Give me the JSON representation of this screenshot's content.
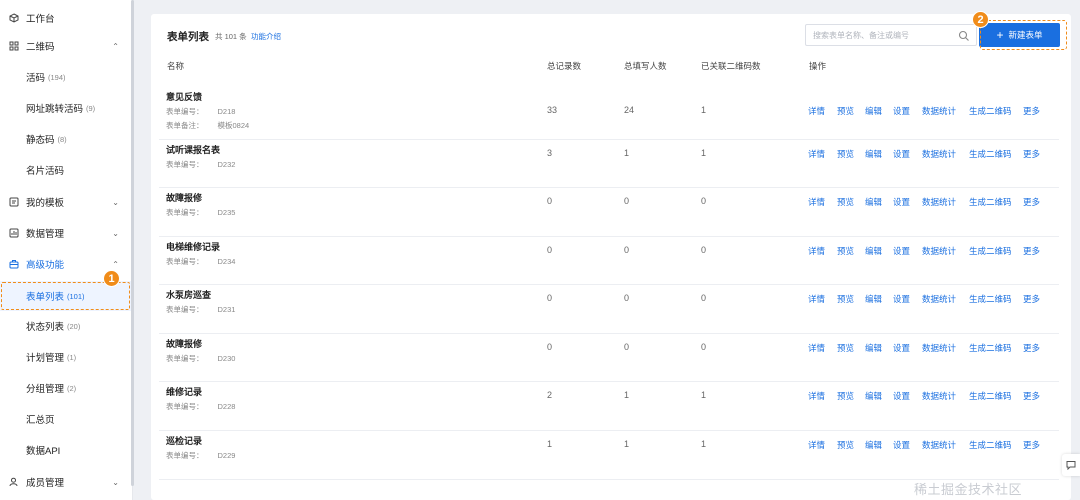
{
  "sidebar": {
    "workbench": "工作台",
    "qrcode": {
      "label": "二维码",
      "items": [
        {
          "label": "活码",
          "count": "(194)"
        },
        {
          "label": "网址跳转活码",
          "count": "(9)"
        },
        {
          "label": "静态码",
          "count": "(8)"
        },
        {
          "label": "名片活码",
          "count": ""
        }
      ]
    },
    "templates": "我的模板",
    "data_mgmt": "数据管理",
    "advanced": {
      "label": "高级功能",
      "items": [
        {
          "label": "表单列表",
          "count": "(101)"
        },
        {
          "label": "状态列表",
          "count": "(20)"
        },
        {
          "label": "计划管理",
          "count": "(1)"
        },
        {
          "label": "分组管理",
          "count": "(2)"
        },
        {
          "label": "汇总页",
          "count": ""
        },
        {
          "label": "数据API",
          "count": ""
        }
      ]
    },
    "members": "成员管理"
  },
  "badges": {
    "one": "1",
    "two": "2"
  },
  "header": {
    "title": "表单列表",
    "count": "共 101 条",
    "intro": "功能介绍",
    "search_placeholder": "搜索表单名称、备注或编号",
    "new_button": "新建表单"
  },
  "table": {
    "columns": [
      "名称",
      "总记录数",
      "总填写人数",
      "已关联二维码数",
      "操作"
    ],
    "id_label": "表单编号：",
    "note_label": "表单备注：",
    "actions": [
      "详情",
      "预览",
      "编辑",
      "设置",
      "数据统计",
      "生成二维码",
      "更多"
    ],
    "rows": [
      {
        "name": "意见反馈",
        "id": "D218",
        "note": "模板0824",
        "records": "33",
        "writers": "24",
        "qrcodes": "1"
      },
      {
        "name": "试听课报名表",
        "id": "D232",
        "records": "3",
        "writers": "1",
        "qrcodes": "1"
      },
      {
        "name": "故障报修",
        "id": "D235",
        "records": "0",
        "writers": "0",
        "qrcodes": "0"
      },
      {
        "name": "电梯维修记录",
        "id": "D234",
        "records": "0",
        "writers": "0",
        "qrcodes": "0"
      },
      {
        "name": "水泵房巡查",
        "id": "D231",
        "records": "0",
        "writers": "0",
        "qrcodes": "0"
      },
      {
        "name": "故障报修",
        "id": "D230",
        "records": "0",
        "writers": "0",
        "qrcodes": "0"
      },
      {
        "name": "维修记录",
        "id": "D228",
        "records": "2",
        "writers": "1",
        "qrcodes": "1"
      },
      {
        "name": "巡检记录",
        "id": "D229",
        "records": "1",
        "writers": "1",
        "qrcodes": "1"
      }
    ]
  },
  "watermark": "稀土掘金技术社区",
  "colors": {
    "accent": "#1a6fe0",
    "highlight": "#f08c1a"
  }
}
